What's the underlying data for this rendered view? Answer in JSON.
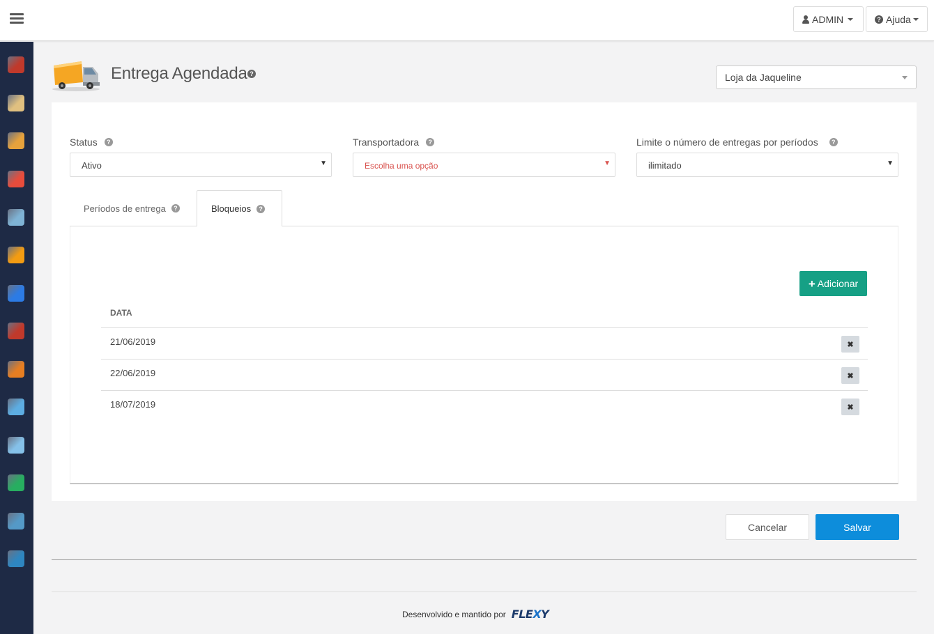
{
  "topbar": {
    "user_label": "ADMIN",
    "help_label": "Ajuda"
  },
  "sidebar": {
    "items": [
      {
        "icon": "database-icon",
        "color": "#c0392b"
      },
      {
        "icon": "building-icon",
        "color": "#e0c080"
      },
      {
        "icon": "box-icon",
        "color": "#e6a23c"
      },
      {
        "icon": "discount-icon",
        "color": "#e74c3c"
      },
      {
        "icon": "card-icon",
        "color": "#7fb3d5"
      },
      {
        "icon": "truck-icon",
        "color": "#f39c12"
      },
      {
        "icon": "document-icon",
        "color": "#2c7be5"
      },
      {
        "icon": "users-icon",
        "color": "#c0392b"
      },
      {
        "icon": "person-icon",
        "color": "#e67e22"
      },
      {
        "icon": "image-icon",
        "color": "#5dade2"
      },
      {
        "icon": "server-icon",
        "color": "#85c1e9"
      },
      {
        "icon": "bar-chart-icon",
        "color": "#27ae60"
      },
      {
        "icon": "monitor-icon",
        "color": "#5499c7"
      },
      {
        "icon": "help-book-icon",
        "color": "#2e86c1"
      }
    ]
  },
  "page": {
    "title": "Entrega Agendada",
    "store": "Loja da Jaqueline"
  },
  "form": {
    "status_label": "Status",
    "status_value": "Ativo",
    "carrier_label": "Transportadora",
    "carrier_placeholder": "Escolha uma opção",
    "limit_label": "Limite o número de entregas por períodos",
    "limit_value": "ilimitado"
  },
  "tabs": [
    {
      "label": "Períodos de entrega",
      "active": false
    },
    {
      "label": "Bloqueios",
      "active": true
    }
  ],
  "blocks": {
    "add_label": "Adicionar",
    "column_header": "DATA",
    "rows": [
      "21/06/2019",
      "22/06/2019",
      "18/07/2019"
    ]
  },
  "actions": {
    "cancel_label": "Cancelar",
    "save_label": "Salvar"
  },
  "footer": {
    "credits": "Desenvolvido e mantido por",
    "brand_a": "FLE",
    "brand_b": "X",
    "brand_c": "Y"
  },
  "colors": {
    "accent_green": "#16a085",
    "accent_blue": "#0d8ddb",
    "sidebar_bg": "#1e2a45",
    "placeholder_red": "#d9534f"
  }
}
